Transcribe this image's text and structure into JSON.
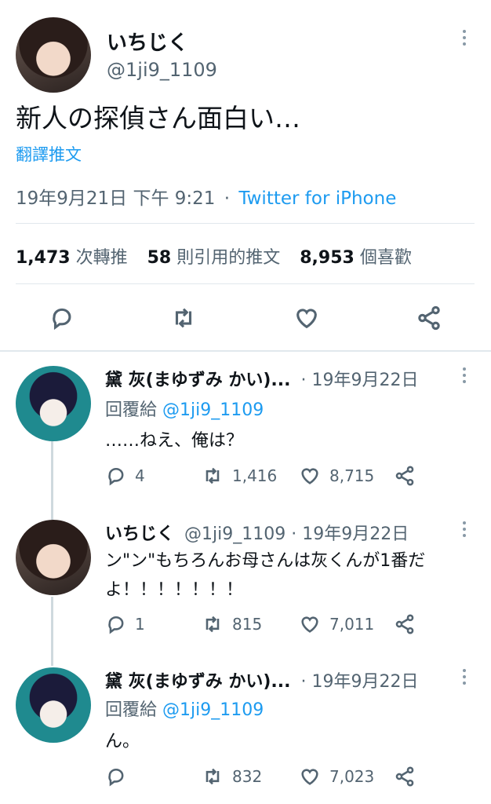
{
  "main_tweet": {
    "display_name": "いちじく",
    "handle": "@1ji9_1109",
    "text": "新人の探偵さん面白い…",
    "translate_label": "翻譯推文",
    "timestamp": "19年9月21日 下午 9:21",
    "separator": "·",
    "source": "Twitter for iPhone",
    "stats": {
      "retweets_count": "1,473",
      "retweets_label": "次轉推",
      "quotes_count": "58",
      "quotes_label": "則引用的推文",
      "likes_count": "8,953",
      "likes_label": "個喜歡"
    }
  },
  "replies": [
    {
      "display_name": "黛 灰(まゆずみ かい)...",
      "meta": "· 19年9月22日",
      "reply_prefix": "回覆給",
      "reply_to": "@1ji9_1109",
      "text": "……ねえ、俺は？",
      "reply_count": "4",
      "retweet_count": "1,416",
      "like_count": "8,715"
    },
    {
      "display_name": "いちじく",
      "meta": "@1ji9_1109 · 19年9月22日",
      "text_line1": "ン\"ン\"もちろんお母さんは灰くんが1番だ",
      "text_line2": "よ！！！！！！！",
      "reply_count": "1",
      "retweet_count": "815",
      "like_count": "7,011"
    },
    {
      "display_name": "黛 灰(まゆずみ かい)...",
      "meta": "· 19年9月22日",
      "reply_prefix": "回覆給",
      "reply_to": "@1ji9_1109",
      "text": "ん。",
      "reply_count": "",
      "retweet_count": "832",
      "like_count": "7,023"
    }
  ],
  "icons": [
    "more-icon",
    "reply-icon",
    "retweet-icon",
    "like-icon",
    "share-icon"
  ],
  "colors": {
    "accent": "#1d9bf0",
    "text": "#0f1419",
    "muted": "#536471",
    "divider": "#e1e8ed"
  }
}
